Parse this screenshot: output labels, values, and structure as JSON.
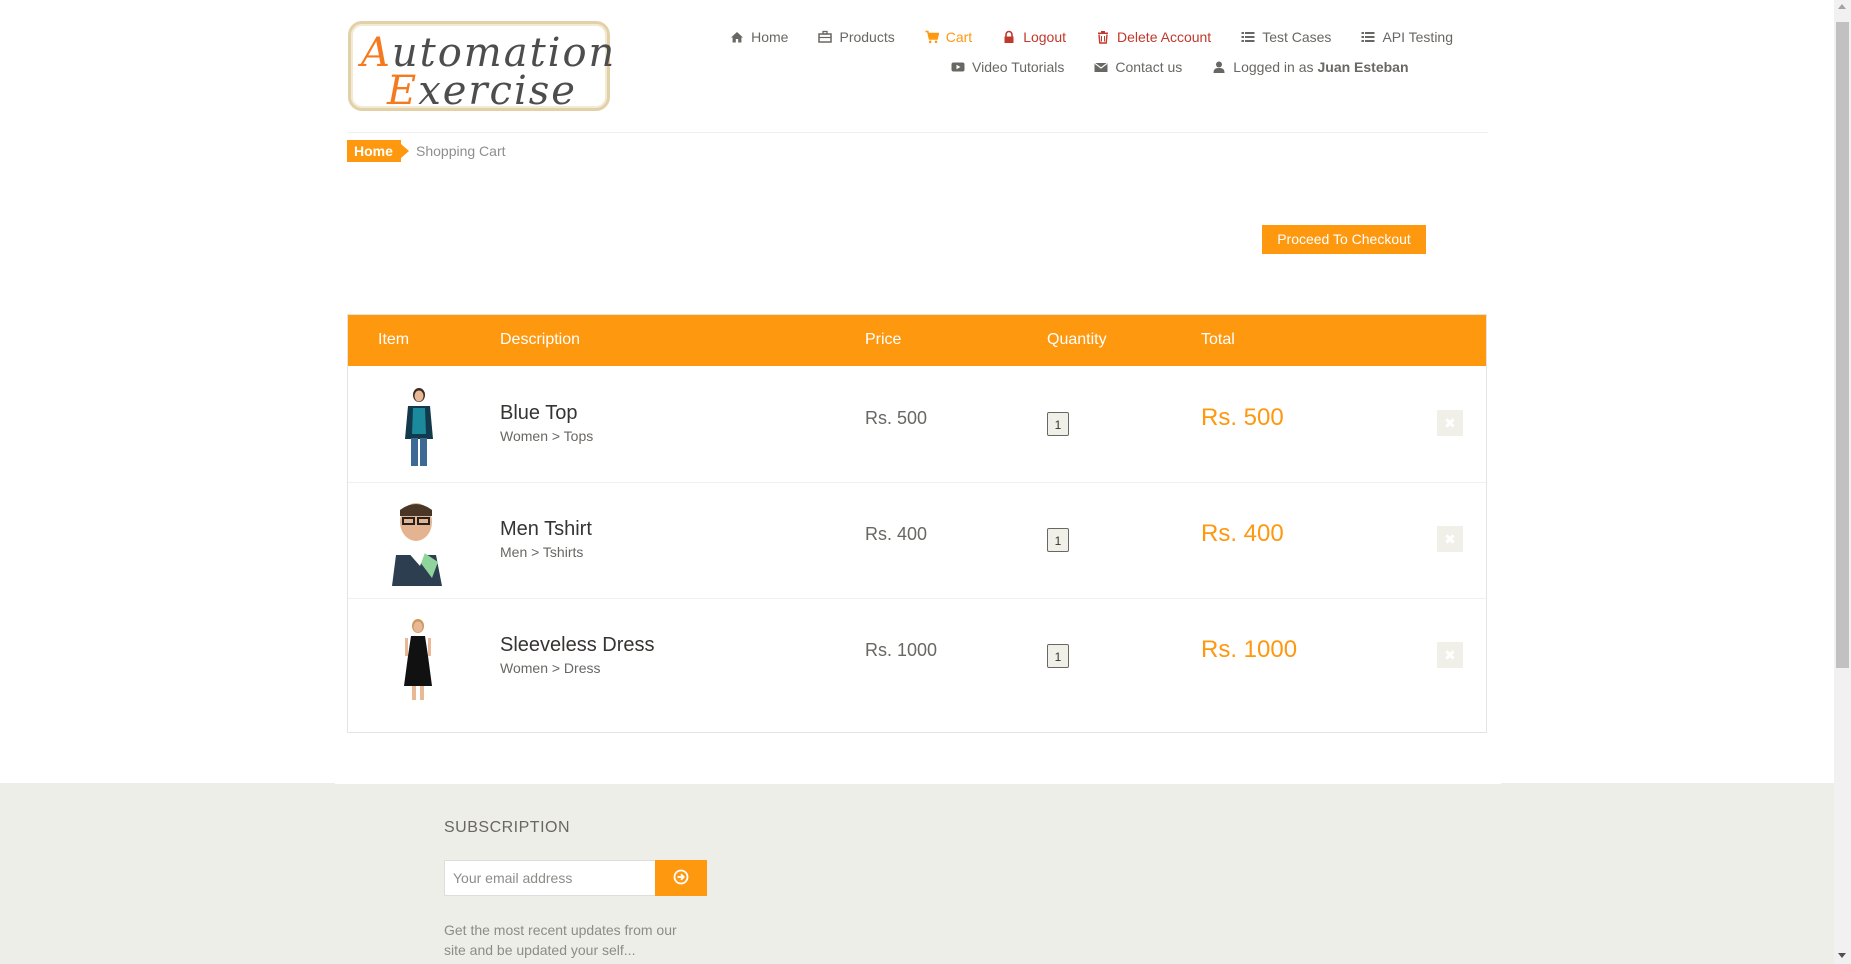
{
  "header": {
    "logo_line1_first": "A",
    "logo_line1_rest": "utomation",
    "logo_line2_first": "E",
    "logo_line2_rest": "xercise",
    "nav": {
      "home": "Home",
      "products": "Products",
      "cart": "Cart",
      "logout": "Logout",
      "delete_account": "Delete Account",
      "test_cases": "Test Cases",
      "api_testing": "API Testing",
      "video_tutorials": "Video Tutorials",
      "contact_us": "Contact us",
      "logged_in_prefix": "Logged in as",
      "logged_in_user": "Juan Esteban"
    }
  },
  "breadcrumb": {
    "home": "Home",
    "current": "Shopping Cart"
  },
  "checkout_button": "Proceed To Checkout",
  "cart": {
    "headers": {
      "item": "Item",
      "description": "Description",
      "price": "Price",
      "quantity": "Quantity",
      "total": "Total"
    },
    "rows": [
      {
        "name": "Blue Top",
        "category": "Women > Tops",
        "price": "Rs. 500",
        "quantity": "1",
        "total": "Rs. 500",
        "delete": "✖"
      },
      {
        "name": "Men Tshirt",
        "category": "Men > Tshirts",
        "price": "Rs. 400",
        "quantity": "1",
        "total": "Rs. 400",
        "delete": "✖"
      },
      {
        "name": "Sleeveless Dress",
        "category": "Women > Dress",
        "price": "Rs. 1000",
        "quantity": "1",
        "total": "Rs. 1000",
        "delete": "✖"
      }
    ]
  },
  "footer": {
    "subscription_title": "SUBSCRIPTION",
    "email_placeholder": "Your email address",
    "description": "Get the most recent updates from our site and be updated your self..."
  },
  "colors": {
    "accent": "#fe980f",
    "danger": "#c0392b",
    "text": "#696763",
    "footer_bg": "#eeeee8"
  },
  "icons": {
    "home": "home-icon",
    "products": "briefcase-icon",
    "cart": "shopping-cart-icon",
    "logout": "lock-icon",
    "delete_account": "trash-icon",
    "test_cases": "list-icon",
    "api_testing": "list-icon",
    "video_tutorials": "youtube-play-icon",
    "contact_us": "envelope-icon",
    "user": "user-icon",
    "subscribe": "arrow-circle-right-icon"
  }
}
